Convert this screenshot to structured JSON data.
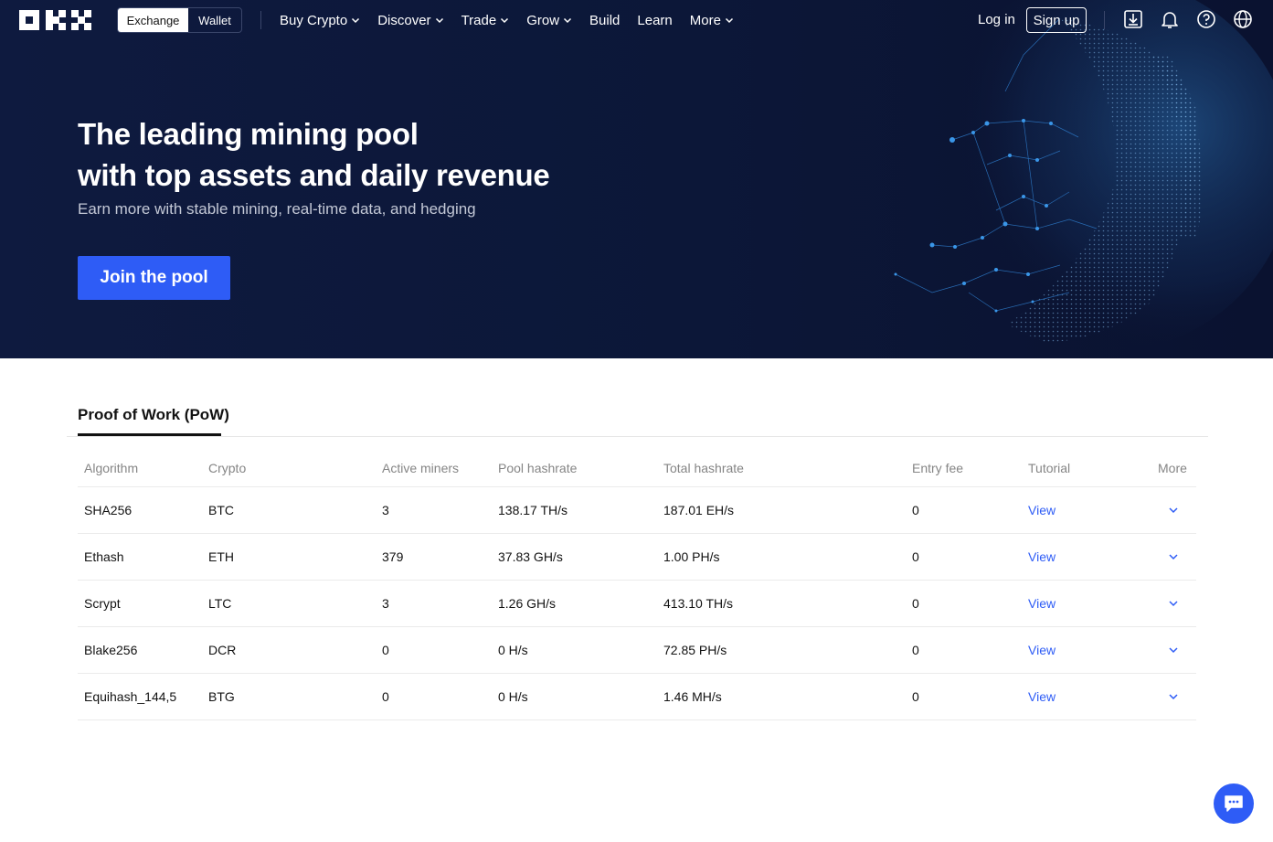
{
  "header": {
    "mode_switch": {
      "active": "Exchange",
      "inactive": "Wallet"
    },
    "nav": [
      {
        "label": "Buy Crypto",
        "has_dropdown": true
      },
      {
        "label": "Discover",
        "has_dropdown": true
      },
      {
        "label": "Trade",
        "has_dropdown": true
      },
      {
        "label": "Grow",
        "has_dropdown": true
      },
      {
        "label": "Build",
        "has_dropdown": false
      },
      {
        "label": "Learn",
        "has_dropdown": false
      },
      {
        "label": "More",
        "has_dropdown": true
      }
    ],
    "login_label": "Log in",
    "signup_label": "Sign up",
    "icons": [
      "download-icon",
      "bell-icon",
      "help-icon",
      "globe-icon"
    ]
  },
  "hero": {
    "title_line1": "The leading mining pool",
    "title_line2": "with top assets and daily revenue",
    "subtitle": "Earn more with stable mining, real-time data, and hedging",
    "cta_label": "Join the pool"
  },
  "tabs": {
    "active": "Proof of Work (PoW)"
  },
  "table": {
    "columns": [
      "Algorithm",
      "Crypto",
      "Active miners",
      "Pool hashrate",
      "Total hashrate",
      "Entry fee",
      "Tutorial",
      "More"
    ],
    "rows": [
      {
        "algorithm": "SHA256",
        "crypto": "BTC",
        "active_miners": "3",
        "pool_hashrate": "138.17 TH/s",
        "total_hashrate": "187.01 EH/s",
        "entry_fee": "0",
        "tutorial": "View"
      },
      {
        "algorithm": "Ethash",
        "crypto": "ETH",
        "active_miners": "379",
        "pool_hashrate": "37.83 GH/s",
        "total_hashrate": "1.00 PH/s",
        "entry_fee": "0",
        "tutorial": "View"
      },
      {
        "algorithm": "Scrypt",
        "crypto": "LTC",
        "active_miners": "3",
        "pool_hashrate": "1.26 GH/s",
        "total_hashrate": "413.10 TH/s",
        "entry_fee": "0",
        "tutorial": "View"
      },
      {
        "algorithm": "Blake256",
        "crypto": "DCR",
        "active_miners": "0",
        "pool_hashrate": "0 H/s",
        "total_hashrate": "72.85 PH/s",
        "entry_fee": "0",
        "tutorial": "View"
      },
      {
        "algorithm": "Equihash_144,5",
        "crypto": "BTG",
        "active_miners": "0",
        "pool_hashrate": "0 H/s",
        "total_hashrate": "1.46 MH/s",
        "entry_fee": "0",
        "tutorial": "View"
      }
    ]
  },
  "colors": {
    "hero_bg": "#0e1a3f",
    "accent": "#2e5cf6",
    "text": "#121212",
    "muted": "#858585"
  }
}
